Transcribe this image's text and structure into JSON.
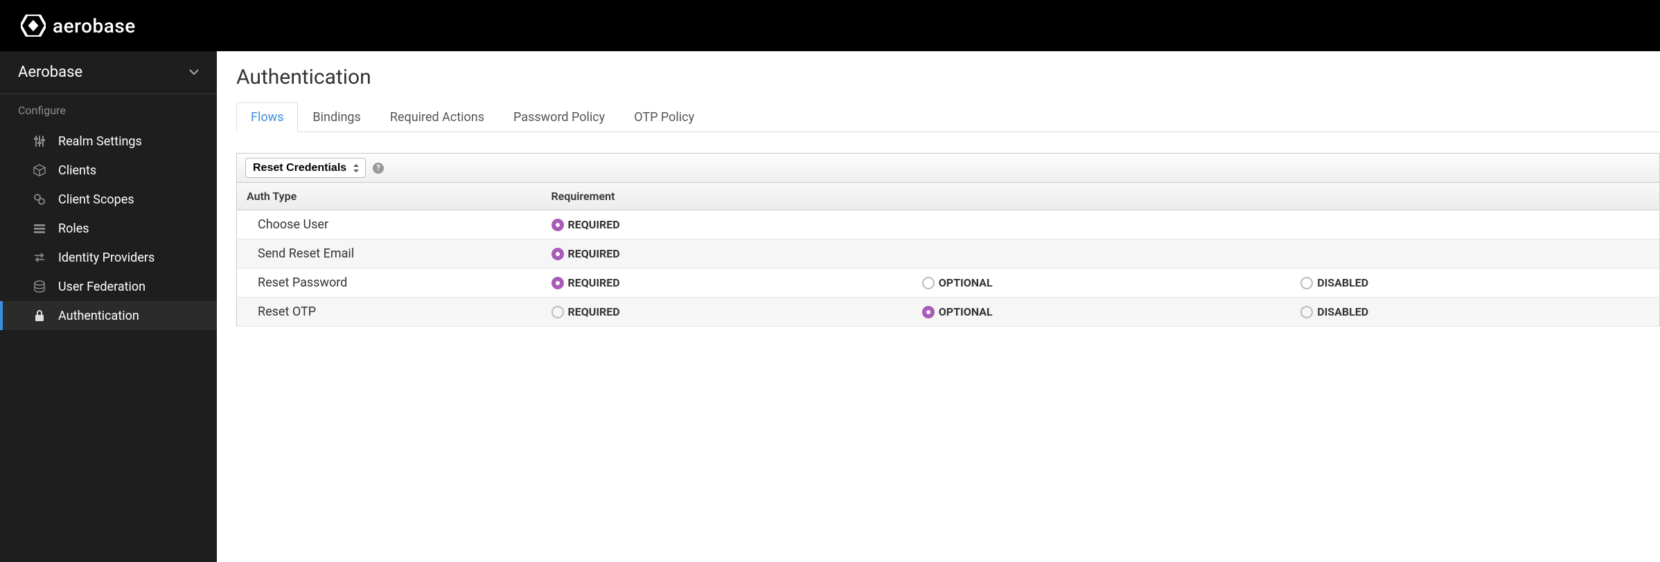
{
  "brand": "aerobase",
  "realm": {
    "name": "Aerobase"
  },
  "sidebar": {
    "section_configure": "Configure",
    "items": [
      {
        "label": "Realm Settings",
        "icon": "sliders-icon"
      },
      {
        "label": "Clients",
        "icon": "cube-icon"
      },
      {
        "label": "Client Scopes",
        "icon": "chain-icon"
      },
      {
        "label": "Roles",
        "icon": "list-icon"
      },
      {
        "label": "Identity Providers",
        "icon": "swap-icon"
      },
      {
        "label": "User Federation",
        "icon": "database-icon"
      },
      {
        "label": "Authentication",
        "icon": "lock-icon",
        "active": true
      }
    ]
  },
  "page_title": "Authentication",
  "tabs": [
    {
      "label": "Flows",
      "active": true
    },
    {
      "label": "Bindings"
    },
    {
      "label": "Required Actions"
    },
    {
      "label": "Password Policy"
    },
    {
      "label": "OTP Policy"
    }
  ],
  "flow_select": {
    "selected": "Reset Credentials"
  },
  "table": {
    "headers": {
      "auth_type": "Auth Type",
      "requirement": "Requirement"
    },
    "requirement_labels": {
      "required": "REQUIRED",
      "optional": "OPTIONAL",
      "disabled": "DISABLED"
    },
    "rows": [
      {
        "auth_type": "Choose User",
        "options": {
          "required": true,
          "optional": null,
          "disabled": null
        },
        "selected": "required"
      },
      {
        "auth_type": "Send Reset Email",
        "options": {
          "required": true,
          "optional": null,
          "disabled": null
        },
        "selected": "required"
      },
      {
        "auth_type": "Reset Password",
        "options": {
          "required": true,
          "optional": true,
          "disabled": true
        },
        "selected": "required"
      },
      {
        "auth_type": "Reset OTP",
        "options": {
          "required": true,
          "optional": true,
          "disabled": true
        },
        "selected": "optional"
      }
    ]
  }
}
